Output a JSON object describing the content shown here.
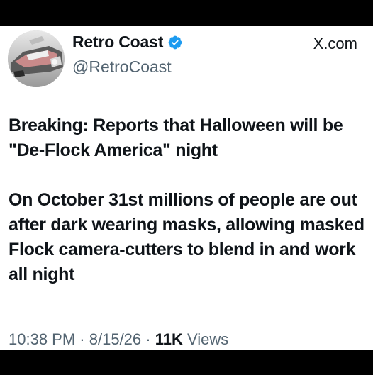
{
  "author": {
    "display_name": "Retro Coast",
    "handle": "@RetroCoast",
    "verified_icon": "verified-badge-icon",
    "avatar_icon": "car-avatar"
  },
  "site_label": "X.com",
  "tweet": {
    "paragraphs": [
      "Breaking: Reports that Halloween will be \"De-Flock America\" night",
      "On October 31st millions of people are out after dark wearing masks, allowing masked Flock camera-cutters to blend in and work all night"
    ]
  },
  "meta": {
    "time": "10:38 PM",
    "separator": "·",
    "date": "8/15/26",
    "views_count": "11K",
    "views_label": "Views"
  },
  "colors": {
    "verified": "#1d9bf0",
    "text_primary": "#0f1419",
    "text_secondary": "#536471",
    "frame": "#000000"
  }
}
